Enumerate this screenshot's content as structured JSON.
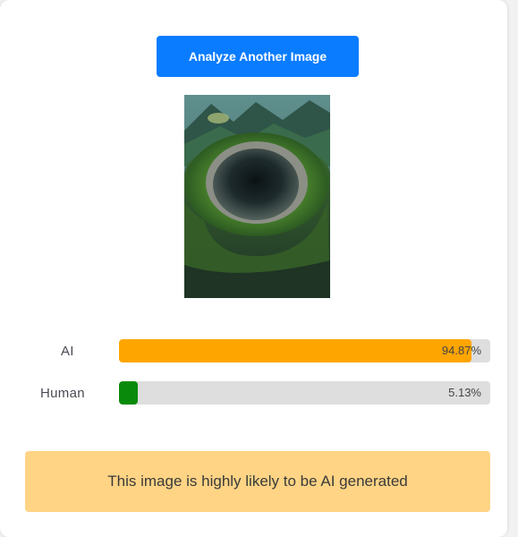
{
  "actions": {
    "analyze_label": "Analyze Another Image"
  },
  "results": [
    {
      "label": "AI",
      "percent_text": "94.87%",
      "value": 94.87,
      "color": "#ffa500"
    },
    {
      "label": "Human",
      "percent_text": "5.13%",
      "value": 5.13,
      "color": "#0a8a0a"
    }
  ],
  "verdict": {
    "text": "This image is highly likely to be AI generated",
    "background": "#ffd485"
  },
  "colors": {
    "primary": "#0a7cff",
    "track": "#dedede"
  }
}
